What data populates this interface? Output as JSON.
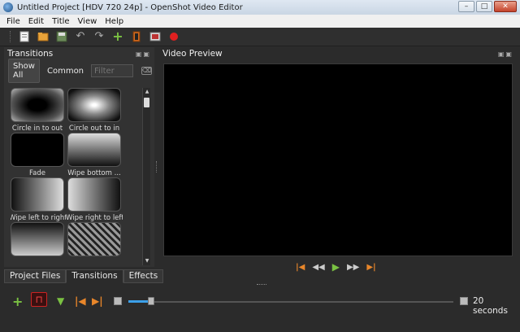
{
  "window": {
    "title": "Untitled Project [HDV 720 24p] - OpenShot Video Editor"
  },
  "menu": [
    "File",
    "Edit",
    "Title",
    "View",
    "Help"
  ],
  "toolbar": {
    "icons": [
      "new-project-icon",
      "open-project-icon",
      "save-project-icon",
      "undo-icon",
      "redo-icon",
      "import-files-icon",
      "profile-icon",
      "export-video-icon",
      "record-icon"
    ]
  },
  "transitions_panel": {
    "title": "Transitions",
    "filter_tabs": [
      "Show All",
      "Common"
    ],
    "filter_placeholder": "Filter",
    "items": [
      {
        "label": "Circle in to out",
        "style": "circle-dark"
      },
      {
        "label": "Circle out to in",
        "style": "circle-light"
      },
      {
        "label": "Fade",
        "style": "black"
      },
      {
        "label": "Wipe bottom ...",
        "style": "grad-down"
      },
      {
        "label": "Wipe left to right",
        "style": "grad-right"
      },
      {
        "label": "Wipe right to left",
        "style": "grad-left"
      },
      {
        "label": "",
        "style": "grad-down"
      },
      {
        "label": "",
        "style": "stripes"
      }
    ]
  },
  "bottom_tabs": [
    "Project Files",
    "Transitions",
    "Effects"
  ],
  "preview_panel": {
    "title": "Video Preview"
  },
  "transport": [
    "jump-start-icon",
    "rewind-icon",
    "play-icon",
    "fast-forward-icon",
    "jump-end-icon"
  ],
  "timeline": {
    "zoom_label": "20 seconds",
    "zoom_level": 0.06
  },
  "colors": {
    "accent": "#3ca0e8",
    "orange": "#e8862a",
    "green": "#7ac142",
    "red": "#e02020"
  }
}
